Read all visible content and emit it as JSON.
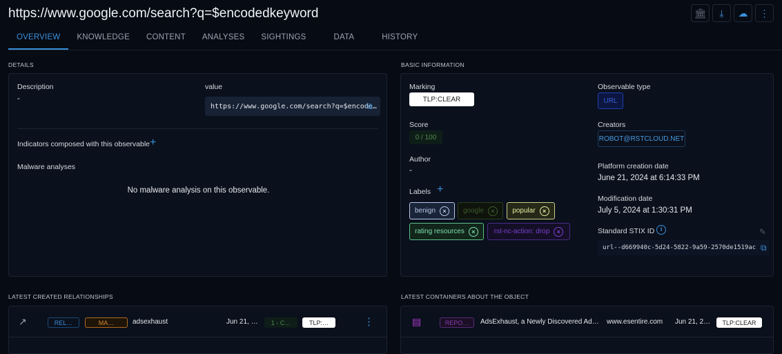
{
  "header": {
    "title": "https://www.google.com/search?q=$encodedkeyword",
    "icons": [
      "bank-add-icon",
      "download-icon",
      "cloud-sync-icon",
      "more-vert-icon"
    ]
  },
  "tabs": [
    "OVERVIEW",
    "KNOWLEDGE",
    "CONTENT",
    "ANALYSES",
    "SIGHTINGS",
    "DATA",
    "HISTORY"
  ],
  "details": {
    "section": "DETAILS",
    "description_label": "Description",
    "description": "-",
    "value_label": "value",
    "value": "https://www.google.com/search?q=$encode…",
    "indicators_label": "Indicators composed with this observable",
    "malware_label": "Malware analyses",
    "malware_empty": "No malware analysis on this observable."
  },
  "basic": {
    "section": "BASIC INFORMATION",
    "marking_label": "Marking",
    "marking": "TLP:CLEAR",
    "score_label": "Score",
    "score": "0 / 100",
    "author_label": "Author",
    "author": "-",
    "labels_label": "Labels",
    "labels": [
      {
        "text": "benign",
        "color": "#b8c8ea"
      },
      {
        "text": "google",
        "color": "#3f5a2a"
      },
      {
        "text": "popular",
        "color": "#e6eea0"
      },
      {
        "text": "rating resources",
        "color": "#7fe0a8"
      },
      {
        "text": "rst-nc-action: drop",
        "color": "#7b3fd0"
      }
    ],
    "type_label": "Observable type",
    "type": "URL",
    "creators_label": "Creators",
    "creator": "ROBOT@RSTCLOUD.NET",
    "created_label": "Platform creation date",
    "created": "June 21, 2024 at 6:14:33 PM",
    "modified_label": "Modification date",
    "modified": "July 5, 2024 at 1:30:31 PM",
    "stix_label": "Standard STIX ID",
    "stix": "url--d669940c-5d24-5822-9a59-2570de1519ac"
  },
  "relationships": {
    "section": "LATEST CREATED RELATIONSHIPS",
    "row": {
      "rel": "REL…",
      "type": "MA…",
      "name": "adsexhaust",
      "date": "Jun 21, …",
      "confidence": "1 - C…",
      "marking": "TLP:…"
    }
  },
  "containers": {
    "section": "LATEST CONTAINERS ABOUT THE OBJECT",
    "row": {
      "type": "REPO…",
      "name": "AdsExhaust, a Newly Discovered Ad…",
      "source": "www.esentire.com",
      "date": "Jun 21, 2…",
      "marking": "TLP:CLEAR"
    }
  }
}
